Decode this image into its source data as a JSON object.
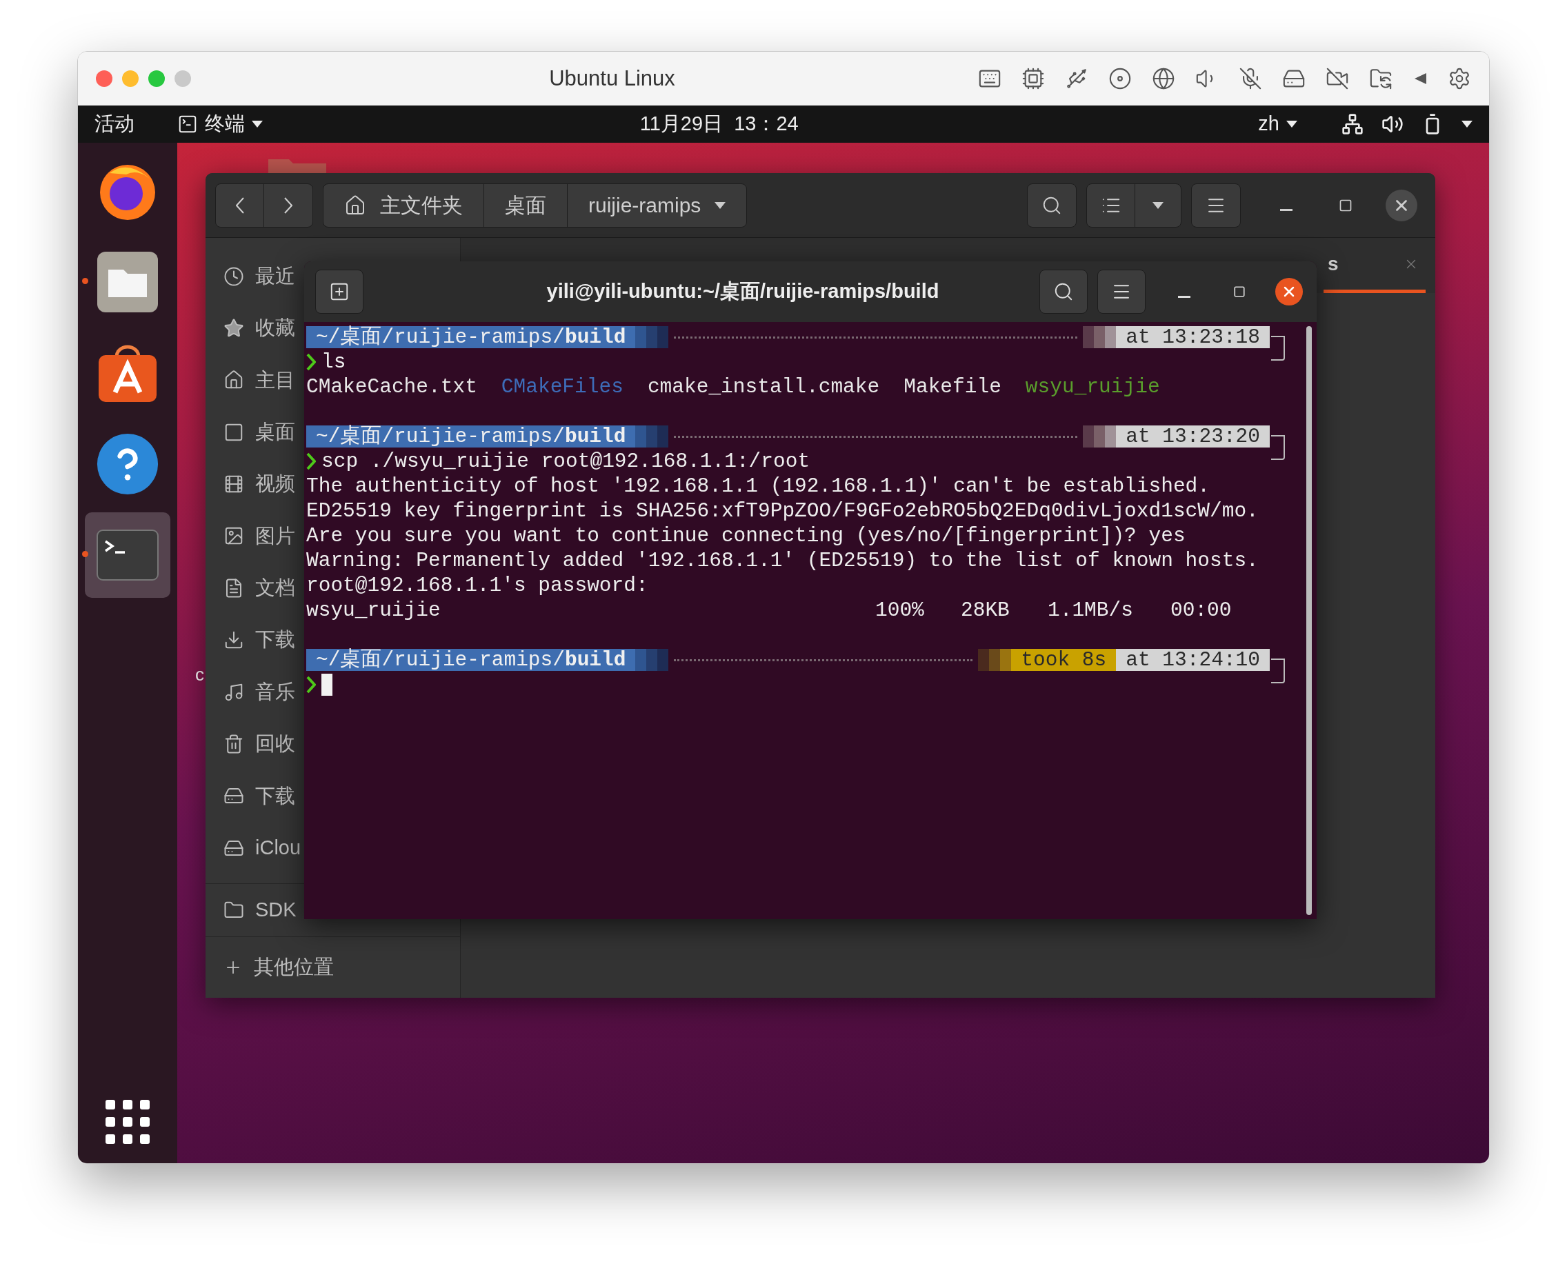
{
  "host_window": {
    "title": "Ubuntu Linux"
  },
  "top_bar": {
    "activities": "活动",
    "app_menu": "终端",
    "clock": "11月29日  13：24",
    "language": "zh"
  },
  "dock": {
    "items": [
      {
        "kind": "firefox",
        "running": false,
        "selected": false
      },
      {
        "kind": "files",
        "running": true,
        "selected": false
      },
      {
        "kind": "software",
        "running": false,
        "selected": false
      },
      {
        "kind": "help",
        "running": false,
        "selected": false
      },
      {
        "kind": "terminal",
        "running": true,
        "selected": true
      }
    ]
  },
  "desktop": {
    "icon_label": "c"
  },
  "file_manager": {
    "breadcrumbs": [
      {
        "label": "主文件夹",
        "kind": "home"
      },
      {
        "label": "桌面",
        "kind": "plain"
      },
      {
        "label": "ruijie-ramips",
        "kind": "menu"
      }
    ],
    "sidebar": [
      {
        "label": "最近",
        "kind": "recent"
      },
      {
        "label": "收藏",
        "kind": "starred"
      },
      {
        "label": "主目",
        "kind": "home"
      },
      {
        "label": "桌面",
        "kind": "desktop"
      },
      {
        "label": "视频",
        "kind": "videos"
      },
      {
        "label": "图片",
        "kind": "pictures"
      },
      {
        "label": "文档",
        "kind": "documents"
      },
      {
        "label": "下载",
        "kind": "downloads"
      },
      {
        "label": "音乐",
        "kind": "music"
      },
      {
        "label": "回收",
        "kind": "trash"
      },
      {
        "label": "下载",
        "kind": "drive"
      },
      {
        "label": "iClou",
        "kind": "drive"
      },
      {
        "label": "SDK",
        "kind": "folder"
      }
    ],
    "other_locations": "其他位置",
    "tab_fragment": "s"
  },
  "terminal": {
    "title": "yili@yili-ubuntu:~/桌面/ruijie-ramips/build",
    "lines": [
      {
        "kind": "prompt",
        "path": "~/桌面/ruijie-ramips/**build**",
        "time": "at 13:23:18"
      },
      {
        "kind": "command",
        "text": "ls"
      },
      {
        "kind": "listing",
        "items": [
          {
            "text": "CMakeCache.txt",
            "color": "#e8e8e8"
          },
          {
            "text": "CMakeFiles",
            "color": "#3d6cb8"
          },
          {
            "text": "cmake_install.cmake",
            "color": "#e8e8e8"
          },
          {
            "text": "Makefile",
            "color": "#e8e8e8"
          },
          {
            "text": "wsyu_ruijie",
            "color": "#5a9e2c"
          }
        ]
      },
      {
        "kind": "prompt",
        "path": "~/桌面/ruijie-ramips/**build**",
        "time": "at 13:23:20"
      },
      {
        "kind": "command",
        "text": "scp ./wsyu_ruijie root@192.168.1.1:/root"
      },
      {
        "kind": "output",
        "text": "The authenticity of host '192.168.1.1 (192.168.1.1)' can't be established."
      },
      {
        "kind": "output",
        "text": "ED25519 key fingerprint is SHA256:xfT9PpZOO/F9GFo2ebRO5bQ2EDq0divLjoxd1scW/mo."
      },
      {
        "kind": "output",
        "text": "Are you sure you want to continue connecting (yes/no/[fingerprint])? yes"
      },
      {
        "kind": "output",
        "text": "Warning: Permanently added '192.168.1.1' (ED25519) to the list of known hosts."
      },
      {
        "kind": "output",
        "text": "root@192.168.1.1's password:"
      },
      {
        "kind": "progress",
        "file": "wsyu_ruijie",
        "percent": "100%",
        "size": "28KB",
        "rate": "1.1MB/s",
        "eta": "00:00"
      },
      {
        "kind": "prompt",
        "path": "~/桌面/ruijie-ramips/**build**",
        "took": "took 8s",
        "time": "at 13:24:10"
      },
      {
        "kind": "input",
        "cursor": true
      }
    ]
  }
}
